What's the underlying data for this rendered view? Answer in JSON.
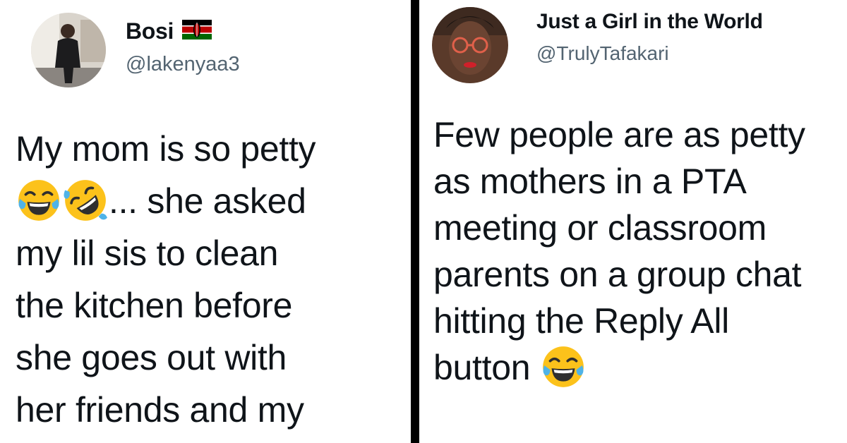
{
  "left_tweet": {
    "author": {
      "display_name": "Bosi",
      "handle": "@lakenyaa3",
      "badge": "kenya-flag"
    },
    "lines": [
      {
        "text": "My mom is so petty"
      },
      {
        "before": "",
        "emojis": [
          "face-with-tears-of-joy",
          "rolling-on-floor-laughing"
        ],
        "after": "... she asked"
      },
      {
        "text": "my lil sis to clean"
      },
      {
        "text": "the kitchen before"
      },
      {
        "text": "she goes out with"
      },
      {
        "text": "her friends and my"
      }
    ]
  },
  "right_tweet": {
    "author": {
      "display_name": "Just a Girl in the World",
      "handle": "@TrulyTafakari"
    },
    "lines": [
      {
        "text": "Few people are as petty"
      },
      {
        "text": "as mothers in a PTA"
      },
      {
        "text": "meeting or classroom"
      },
      {
        "text": "parents on a group chat"
      },
      {
        "text": "hitting the Reply All"
      },
      {
        "before": "button ",
        "emojis": [
          "face-with-tears-of-joy"
        ]
      }
    ]
  },
  "colors": {
    "text": "#0f1419",
    "handle": "#536471",
    "divider": "#000000",
    "background": "#ffffff"
  }
}
